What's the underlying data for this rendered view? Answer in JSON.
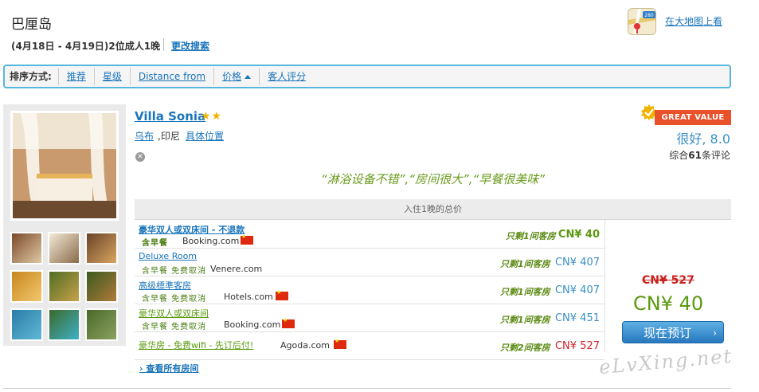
{
  "header": {
    "title": "巴厘岛",
    "subline": "(4月18日 - 4月19日)2位成人1晚",
    "modify_link": "更改搜索",
    "map_icon_badge": "280",
    "map_link": "在大地图上看"
  },
  "sortbar": {
    "label": "排序方式:",
    "items": [
      "推荐",
      "星级",
      "Distance from",
      "价格",
      "客人评分"
    ]
  },
  "hotel": {
    "name": "Villa Sonia",
    "stars": "★★",
    "area": "乌布",
    "country": ",印尼",
    "location_link": "具体位置",
    "badge": "GREAT VALUE",
    "score": "很好, 8.0",
    "reviews_prefix": "综合",
    "reviews_count": "61",
    "reviews_suffix": "条评论",
    "quote": "“淋浴设备不错”,“房间很大”,“早餐很美味”"
  },
  "rooms": {
    "header": "入住1晚的总价",
    "items": [
      {
        "name": "豪华双人或双床间 - 不退款",
        "amenities": "含早餐",
        "source": "Booking.com",
        "only": "只剩1间客房",
        "price": "CN¥ 40"
      },
      {
        "name": "Deluxe Room",
        "amenities": "含早餐 免费取消",
        "source": "Venere.com",
        "only": "只剩1间客房",
        "price": "CN¥ 407"
      },
      {
        "name": "高级標準客房",
        "amenities": "含早餐 免费取消",
        "source": "Hotels.com",
        "only": "只剩1间客房",
        "price": "CN¥ 407"
      },
      {
        "name": "豪华双人或双床间",
        "amenities": "含早餐 免费取消",
        "source": "Booking.com",
        "only": "只剩1间客房",
        "price": "CN¥ 451"
      },
      {
        "name": "豪华房 - 免费wifi - 先订后付!",
        "amenities": "",
        "source": "Agoda.com",
        "only": "只剩2间客房",
        "price": "CN¥ 527"
      }
    ],
    "all_link": "查看所有房间"
  },
  "pricing": {
    "old_price": "CN¥ 527",
    "new_price": "CN¥ 40",
    "book_button": "现在预订"
  },
  "watermark": "eLvXing.net",
  "colors": {
    "accent": "#1a75bb",
    "sortbar_border": "#57b6df",
    "badge": "#e8512a",
    "green_price": "#5b9a10",
    "strike_red": "#c8211b"
  }
}
